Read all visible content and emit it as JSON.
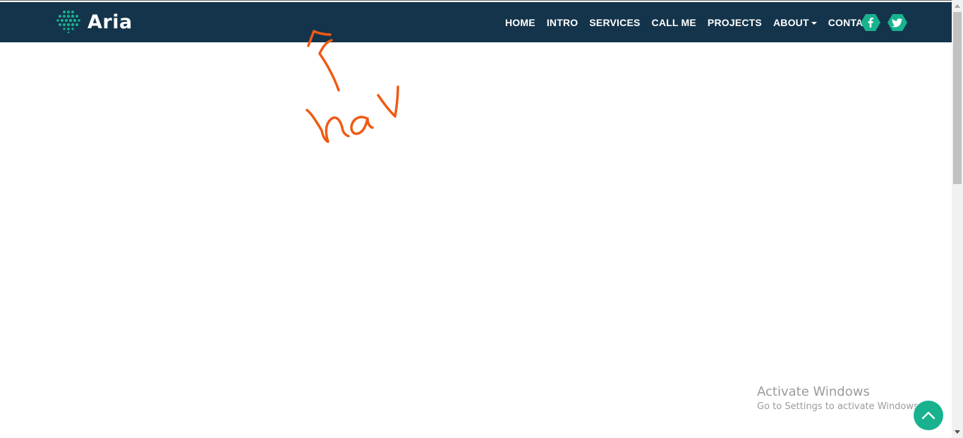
{
  "brand": {
    "name": "Aria",
    "icon": "dots-logo-icon"
  },
  "nav": {
    "items": [
      {
        "label": "HOME"
      },
      {
        "label": "INTRO"
      },
      {
        "label": "SERVICES"
      },
      {
        "label": "CALL ME"
      },
      {
        "label": "PROJECTS"
      },
      {
        "label": "ABOUT",
        "has_dropdown": true
      },
      {
        "label": "CONTACT"
      }
    ],
    "social": [
      {
        "icon": "facebook-icon"
      },
      {
        "icon": "twitter-icon"
      }
    ]
  },
  "annotation": {
    "text": "nav",
    "color": "#f05a14"
  },
  "watermark": {
    "title": "Activate Windows",
    "subtitle": "Go to Settings to activate Windows."
  },
  "back_to_top": {
    "icon": "chevron-up-icon"
  },
  "colors": {
    "navbar_bg": "#14344b",
    "accent": "#18b28f",
    "nav_text": "#ffffff",
    "annotation": "#f05a14"
  }
}
